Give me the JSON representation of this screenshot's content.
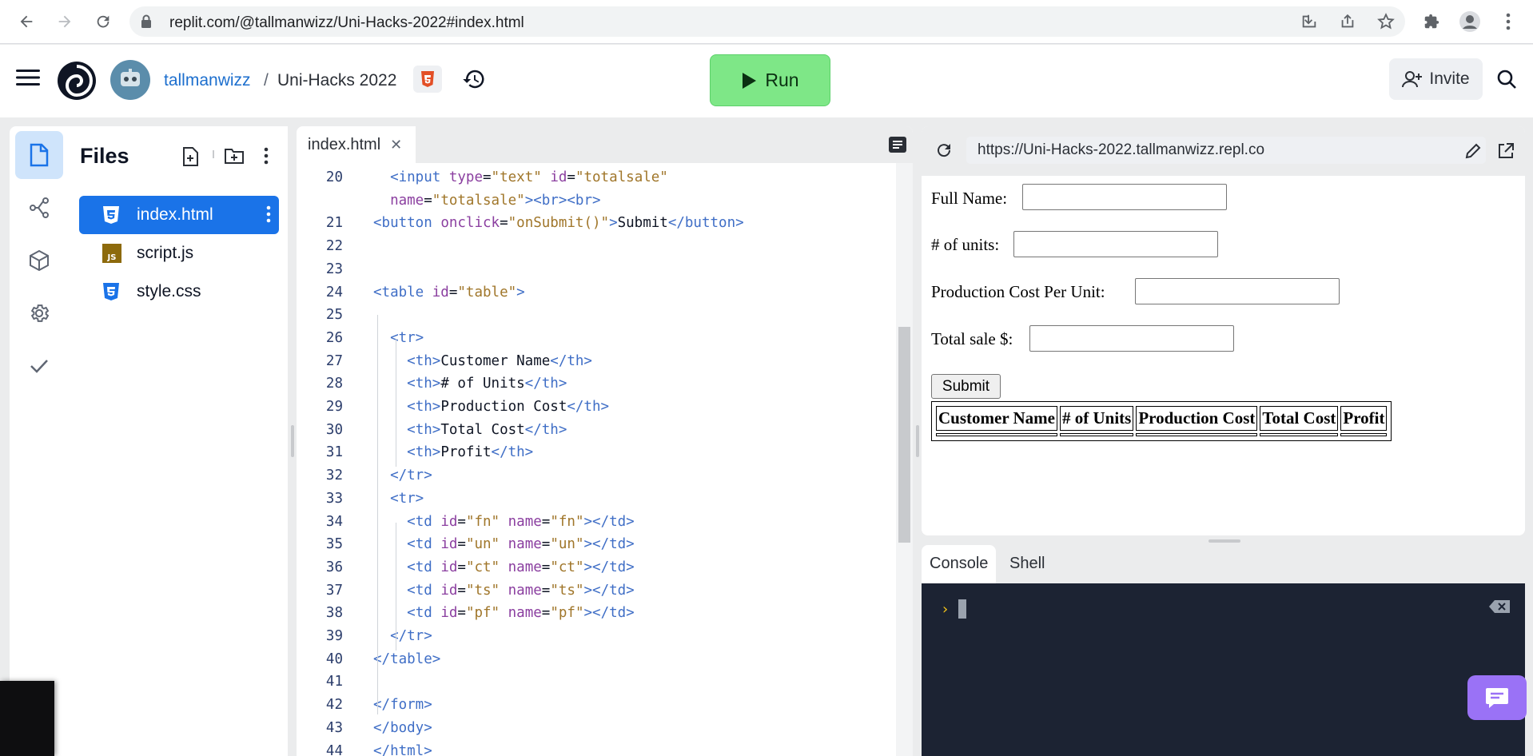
{
  "browser": {
    "url": "replit.com/@tallmanwizz/Uni-Hacks-2022#index.html"
  },
  "header": {
    "owner": "tallmanwizz",
    "separator": "/",
    "repl_name": "Uni-Hacks 2022",
    "run_label": "Run",
    "invite_label": "Invite"
  },
  "files": {
    "title": "Files",
    "items": [
      {
        "name": "index.html",
        "active": true
      },
      {
        "name": "script.js",
        "active": false
      },
      {
        "name": "style.css",
        "active": false
      }
    ]
  },
  "editor": {
    "tab_label": "index.html",
    "lines": [
      {
        "n": "20",
        "html": "  <span class=\"tag\">&lt;input</span> <span class=\"attr\">type</span>=<span class=\"str\">\"text\"</span> <span class=\"attr\">id</span>=<span class=\"str\">\"totalsale\"</span>"
      },
      {
        "n": "",
        "html": "  <span class=\"attr\">name</span>=<span class=\"str\">\"totalsale\"</span><span class=\"tag\">&gt;&lt;br&gt;&lt;br&gt;</span>"
      },
      {
        "n": "21",
        "html": "<span class=\"tag\">&lt;button</span> <span class=\"attr\">onclick</span>=<span class=\"str\">\"onSubmit()\"</span><span class=\"tag\">&gt;</span>Submit<span class=\"tag\">&lt;/button&gt;</span>"
      },
      {
        "n": "22",
        "html": ""
      },
      {
        "n": "23",
        "html": ""
      },
      {
        "n": "24",
        "html": "<span class=\"tag\">&lt;table</span> <span class=\"attr\">id</span>=<span class=\"str\">\"table\"</span><span class=\"tag\">&gt;</span>"
      },
      {
        "n": "25",
        "html": ""
      },
      {
        "n": "26",
        "html": "  <span class=\"tag\">&lt;tr&gt;</span>"
      },
      {
        "n": "27",
        "html": "    <span class=\"tag\">&lt;th&gt;</span>Customer Name<span class=\"tag\">&lt;/th&gt;</span>"
      },
      {
        "n": "28",
        "html": "    <span class=\"tag\">&lt;th&gt;</span># of Units<span class=\"tag\">&lt;/th&gt;</span>"
      },
      {
        "n": "29",
        "html": "    <span class=\"tag\">&lt;th&gt;</span>Production Cost<span class=\"tag\">&lt;/th&gt;</span>"
      },
      {
        "n": "30",
        "html": "    <span class=\"tag\">&lt;th&gt;</span>Total Cost<span class=\"tag\">&lt;/th&gt;</span>"
      },
      {
        "n": "31",
        "html": "    <span class=\"tag\">&lt;th&gt;</span>Profit<span class=\"tag\">&lt;/th&gt;</span>"
      },
      {
        "n": "32",
        "html": "  <span class=\"tag\">&lt;/tr&gt;</span>"
      },
      {
        "n": "33",
        "html": "  <span class=\"tag\">&lt;tr&gt;</span>"
      },
      {
        "n": "34",
        "html": "    <span class=\"tag\">&lt;td</span> <span class=\"attr\">id</span>=<span class=\"str\">\"fn\"</span> <span class=\"attr\">name</span>=<span class=\"str\">\"fn\"</span><span class=\"tag\">&gt;&lt;/td&gt;</span>"
      },
      {
        "n": "35",
        "html": "    <span class=\"tag\">&lt;td</span> <span class=\"attr\">id</span>=<span class=\"str\">\"un\"</span> <span class=\"attr\">name</span>=<span class=\"str\">\"un\"</span><span class=\"tag\">&gt;&lt;/td&gt;</span>"
      },
      {
        "n": "36",
        "html": "    <span class=\"tag\">&lt;td</span> <span class=\"attr\">id</span>=<span class=\"str\">\"ct\"</span> <span class=\"attr\">name</span>=<span class=\"str\">\"ct\"</span><span class=\"tag\">&gt;&lt;/td&gt;</span>"
      },
      {
        "n": "37",
        "html": "    <span class=\"tag\">&lt;td</span> <span class=\"attr\">id</span>=<span class=\"str\">\"ts\"</span> <span class=\"attr\">name</span>=<span class=\"str\">\"ts\"</span><span class=\"tag\">&gt;&lt;/td&gt;</span>"
      },
      {
        "n": "38",
        "html": "    <span class=\"tag\">&lt;td</span> <span class=\"attr\">id</span>=<span class=\"str\">\"pf\"</span> <span class=\"attr\">name</span>=<span class=\"str\">\"pf\"</span><span class=\"tag\">&gt;&lt;/td&gt;</span>"
      },
      {
        "n": "39",
        "html": "  <span class=\"tag\">&lt;/tr&gt;</span>"
      },
      {
        "n": "40",
        "html": "<span class=\"tag\">&lt;/table&gt;</span>"
      },
      {
        "n": "41",
        "html": ""
      },
      {
        "n": "42",
        "html": "<span class=\"tag\">&lt;/form&gt;</span>"
      },
      {
        "n": "43",
        "html": "<span class=\"tag\">&lt;/body&gt;</span>"
      },
      {
        "n": "44",
        "html": "<span class=\"tag\">&lt;/html&gt;</span>"
      }
    ]
  },
  "webview": {
    "url": "https://Uni-Hacks-2022.tallmanwizz.repl.co",
    "form": {
      "full_name_label": "Full Name:",
      "units_label": "# of units:",
      "cost_label": "Production Cost Per Unit:",
      "sale_label": "Total sale $:",
      "submit_label": "Submit"
    },
    "table_headers": [
      "Customer Name",
      "# of Units",
      "Production Cost",
      "Total Cost",
      "Profit"
    ]
  },
  "console": {
    "tabs": [
      "Console",
      "Shell"
    ],
    "prompt": "›"
  },
  "colors": {
    "run_green": "#7ee787",
    "accent_blue": "#1a73e8",
    "console_bg": "#1c2333",
    "chat_purple": "#9a72f6"
  }
}
